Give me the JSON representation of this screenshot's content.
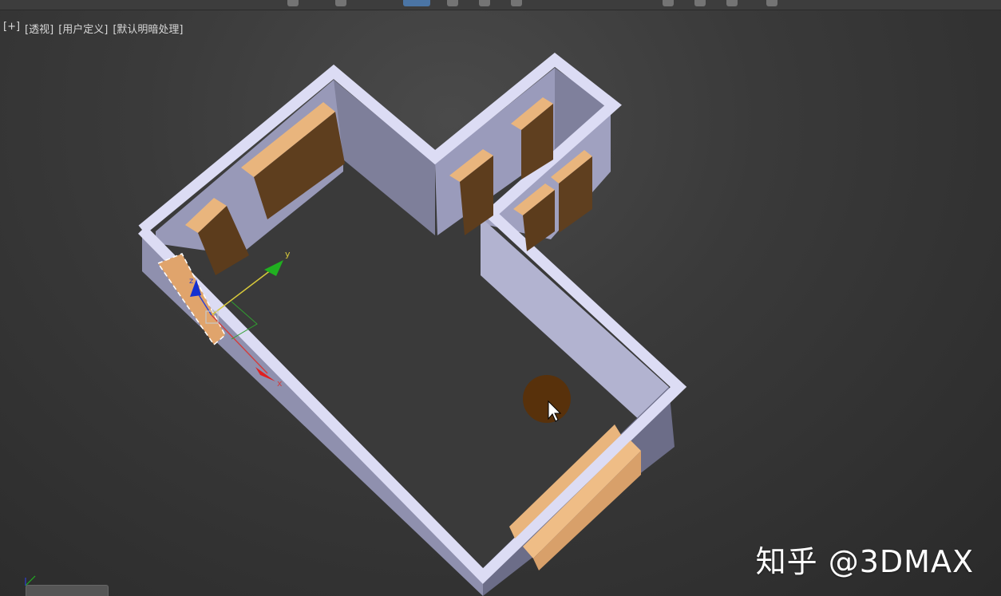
{
  "viewport": {
    "labels": [
      "[+]",
      "[透视]",
      "[用户定义]",
      "[默认明暗处理]"
    ],
    "label_names": [
      "viewport-plus-menu",
      "viewport-view-menu",
      "viewport-user-defined-menu",
      "viewport-shading-menu"
    ]
  },
  "gizmo": {
    "axis_x": "x",
    "axis_y": "y",
    "axis_z": "z"
  },
  "watermark": {
    "text": "知乎 @3DMAX"
  },
  "colors": {
    "wall_top": "#dcdcf4",
    "wall_side": "#a9aac8",
    "floor": "#3b3b3b",
    "cabinet_top": "#e9b57d",
    "cabinet_side": "#5f3f1f",
    "axis_x": "#e02020",
    "axis_y": "#20b020",
    "axis_z": "#1530d0",
    "cursor_halo": "#5a3008"
  }
}
